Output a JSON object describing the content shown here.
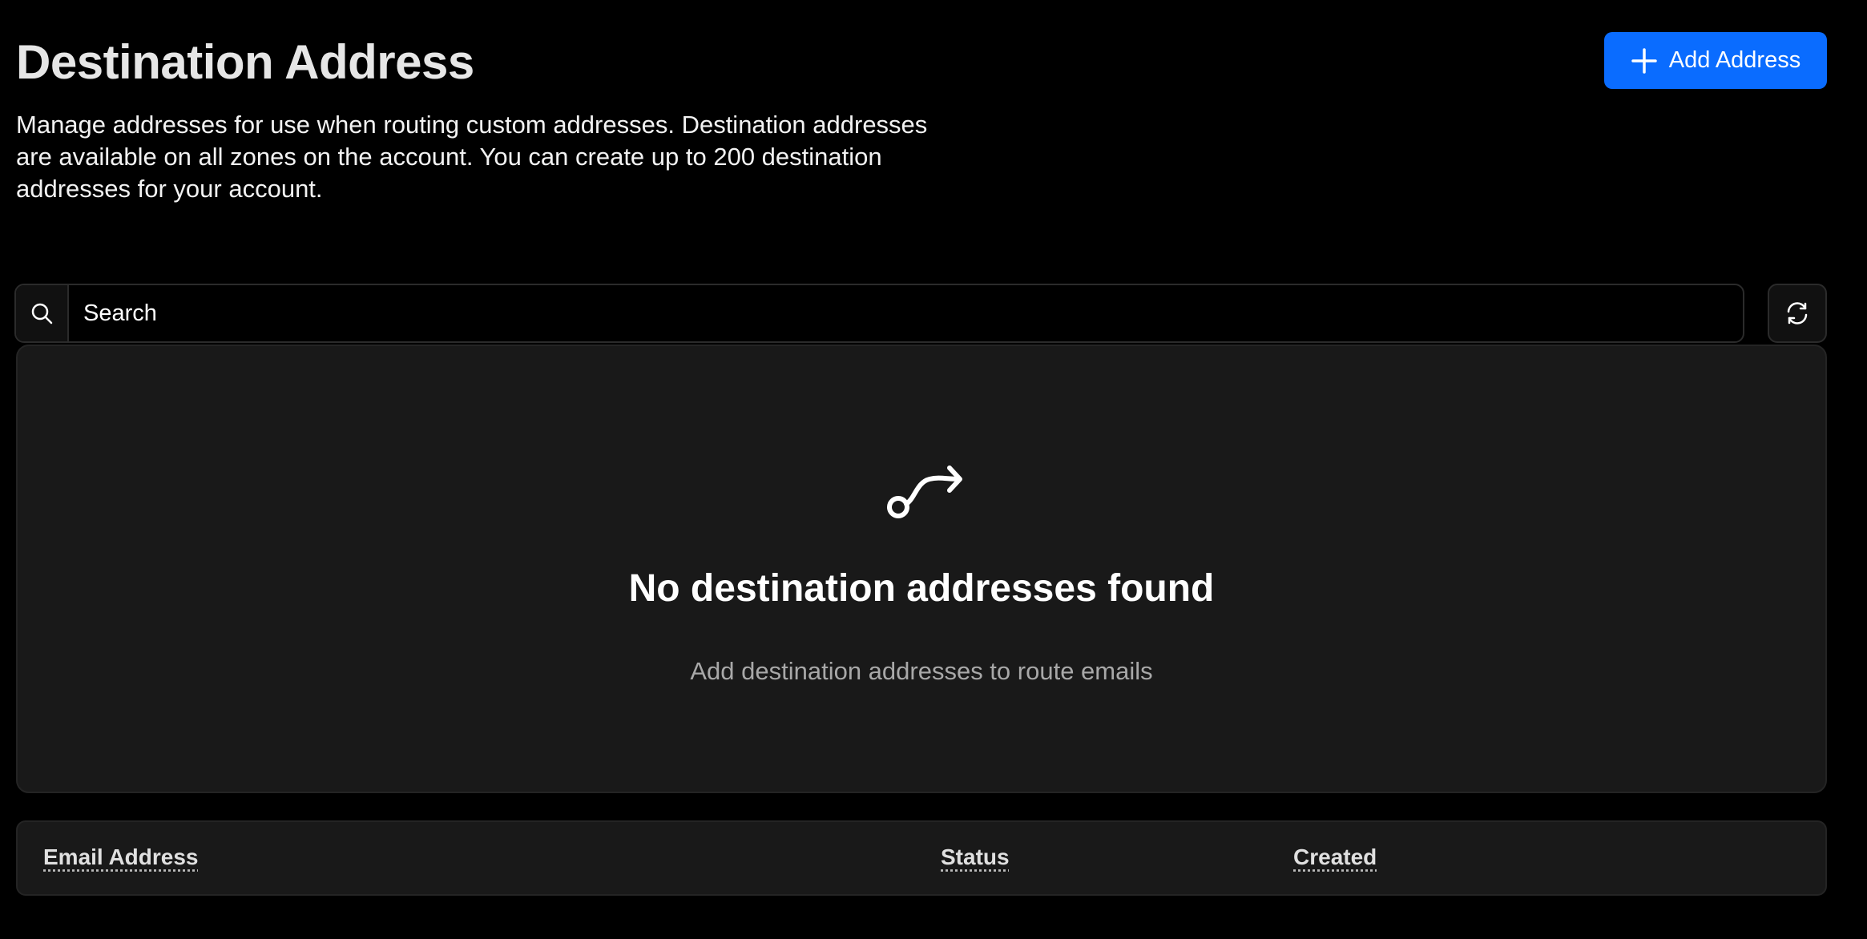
{
  "header": {
    "title": "Destination Address",
    "description": "Manage addresses for use when routing custom addresses. Destination addresses are available on all zones on the account. You can create up to 200 destination addresses for your account."
  },
  "actions": {
    "add_label": "Add Address",
    "add_icon": "plus-icon",
    "refresh_icon": "refresh-icon"
  },
  "search": {
    "placeholder": "Search",
    "value": "",
    "icon": "search-icon"
  },
  "empty_state": {
    "icon": "route-icon",
    "title": "No destination addresses found",
    "subtitle": "Add destination addresses to route emails"
  },
  "table": {
    "columns": [
      "Email Address",
      "Status",
      "Created"
    ]
  },
  "colors": {
    "accent": "#0a6cff",
    "background": "#000000",
    "panel": "#191919",
    "muted_text": "#a8a8a8"
  }
}
